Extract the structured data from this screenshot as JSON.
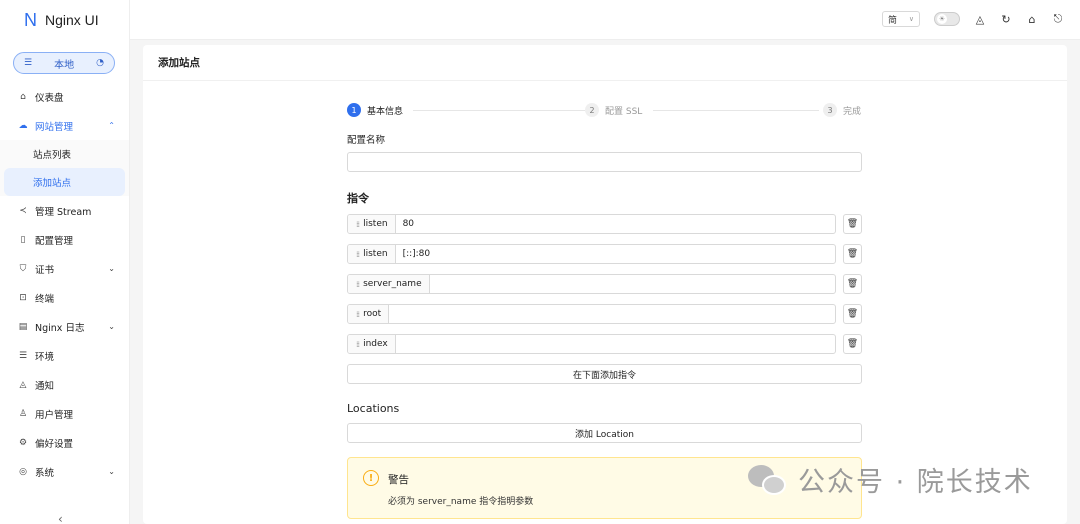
{
  "app": {
    "logo_mark": "N",
    "title": "Nginx UI"
  },
  "env": {
    "label": "本地",
    "left_icon": "list-icon",
    "right_icon": "dashboard-icon"
  },
  "menu": {
    "dashboard": "仪表盘",
    "sites": "网站管理",
    "site_list": "站点列表",
    "add_site": "添加站点",
    "stream": "管理 Stream",
    "config": "配置管理",
    "cert": "证书",
    "terminal": "终端",
    "nginx_log": "Nginx 日志",
    "environment": "环境",
    "notification": "通知",
    "users": "用户管理",
    "preferences": "偏好设置",
    "system": "系统"
  },
  "header": {
    "lang": "简"
  },
  "page": {
    "title": "添加站点"
  },
  "steps": [
    {
      "num": "1",
      "label": "基本信息",
      "active": true
    },
    {
      "num": "2",
      "label": "配置 SSL",
      "active": false
    },
    {
      "num": "3",
      "label": "完成",
      "active": false
    }
  ],
  "form": {
    "config_name_label": "配置名称",
    "config_name_value": "",
    "directives_title": "指令",
    "directives": [
      {
        "key": "listen",
        "value": "80"
      },
      {
        "key": "listen",
        "value": "[::]:80"
      },
      {
        "key": "server_name",
        "value": ""
      },
      {
        "key": "root",
        "value": ""
      },
      {
        "key": "index",
        "value": ""
      }
    ],
    "add_directive_label": "在下面添加指令",
    "locations_title": "Locations",
    "add_location_label": "添加 Location"
  },
  "alert": {
    "title": "警告",
    "message": "必须为 server_name 指令指明参数"
  },
  "watermark": {
    "text": "公众号 · 院长技术"
  },
  "colors": {
    "accent": "#2f6fed",
    "warning_bg": "#fffbe6",
    "warning_border": "#ffe58f",
    "warning_icon": "#faad14"
  }
}
